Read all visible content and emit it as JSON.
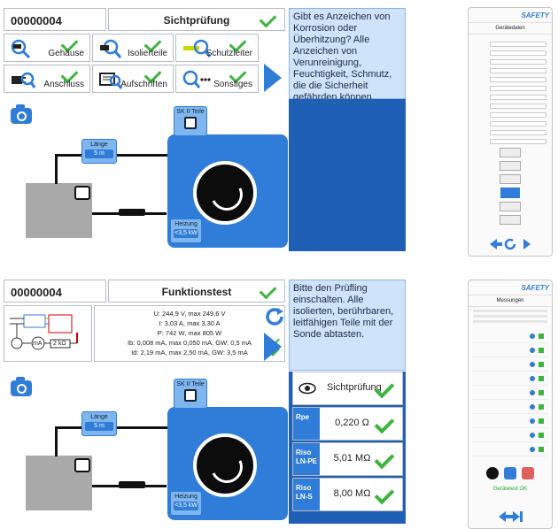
{
  "panel1": {
    "device_id": "00000004",
    "title": "Sichtprüfung",
    "instruction": "Gibt es Anzeichen von Korrosion oder Überhitzung? Alle Anzeichen von Verunreinigung, Feuchtigkeit, Schmutz, die die Sicherheit gefährden können.",
    "tiles": [
      {
        "label": "Gehäuse",
        "icon": "magnifier-housing-icon"
      },
      {
        "label": "Isolierteile",
        "icon": "insulation-icon"
      },
      {
        "label": "Schutzleiter",
        "icon": "protective-conductor-icon"
      },
      {
        "label": "Anschluss",
        "icon": "plug-icon"
      },
      {
        "label": "Aufschriften",
        "icon": "labels-icon"
      },
      {
        "label": "Sonstiges",
        "icon": "magnifier-more-icon"
      }
    ],
    "diagram": {
      "class_label": "SK II Teile",
      "length_label": "Länge",
      "length_value": "5 m",
      "heating_label": "Heizung",
      "heating_value": "<3,5 kW"
    }
  },
  "panel2": {
    "device_id": "00000004",
    "title": "Funktionstest",
    "instruction": "Bitte den Prüfling einschalten. Alle isolierten, berührbaren, leitfähigen Teile mit der Sonde abtasten.",
    "readings": [
      "U: 244,9 V, max 249,6 V",
      "I: 3,03 A, max 3,30 A",
      "P: 742 W, max 805 W",
      "Ib: 0,008 mA, max 0,050 mA, GW: 0,5 mA",
      "Id: 2,19 mA, max 2,50 mA, GW: 3,5 mA"
    ],
    "circuit_labels": {
      "ma": "mA",
      "resistor": "2 kΩ"
    },
    "diagram": {
      "class_label": "SK II Teile",
      "length_label": "Länge",
      "length_value": "5 m",
      "heating_label": "Heizung",
      "heating_value": "<3,5 kW"
    },
    "visual_check_label": "Sichtprüfung",
    "measurements": [
      {
        "name": "Rpe",
        "value": "0,220 Ω"
      },
      {
        "name": "Riso LN-PE",
        "value": "5,01 MΩ"
      },
      {
        "name": "Riso LN-S",
        "value": "8,00 MΩ"
      }
    ]
  },
  "phones": {
    "logo": "SAFETY",
    "top_title": "Gerätedaten",
    "bottom_title": "Messungen",
    "bottom_status": "Gerätetest OK"
  },
  "colors": {
    "accent": "#2f7dd9",
    "ok": "#3db43d",
    "instruction_bg": "#cfe3fa",
    "dark_panel": "#1f5fb6"
  }
}
